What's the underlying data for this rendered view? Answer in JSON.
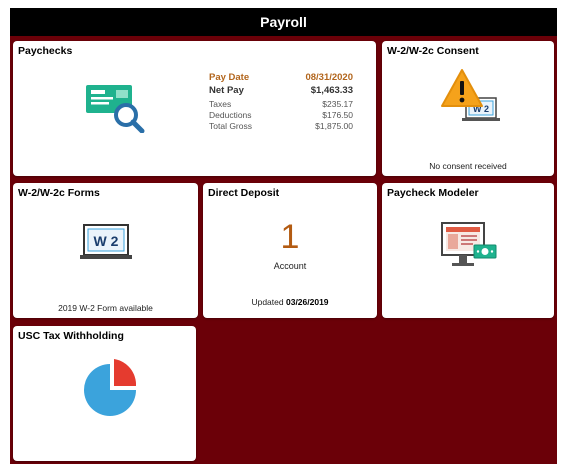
{
  "header": {
    "title": "Payroll"
  },
  "paychecks": {
    "title": "Paychecks",
    "pay_date_label": "Pay Date",
    "pay_date_value": "08/31/2020",
    "net_pay_label": "Net Pay",
    "net_pay_value": "$1,463.33",
    "taxes_label": "Taxes",
    "taxes_value": "$235.17",
    "deductions_label": "Deductions",
    "deductions_value": "$176.50",
    "total_gross_label": "Total Gross",
    "total_gross_value": "$1,875.00"
  },
  "consent": {
    "title": "W-2/W-2c Consent",
    "status": "No consent received",
    "icon": "warning-w2-icon"
  },
  "w2_forms": {
    "title": "W-2/W-2c Forms",
    "badge": "W 2",
    "status": "2019 W-2 Form available"
  },
  "direct_deposit": {
    "title": "Direct Deposit",
    "count": "1",
    "count_label": "Account",
    "updated_label": "Updated",
    "updated_date": "03/26/2019"
  },
  "modeler": {
    "title": "Paycheck Modeler",
    "icon": "monitor-money-icon"
  },
  "usc_tax": {
    "title": "USC Tax Withholding",
    "icon": "pie-chart-icon"
  },
  "colors": {
    "frame": "#6b0008",
    "header": "#000000",
    "accent_orange": "#b35b12",
    "teal": "#1fb28e",
    "blue": "#3ba3dc",
    "red": "#e53b2f"
  }
}
